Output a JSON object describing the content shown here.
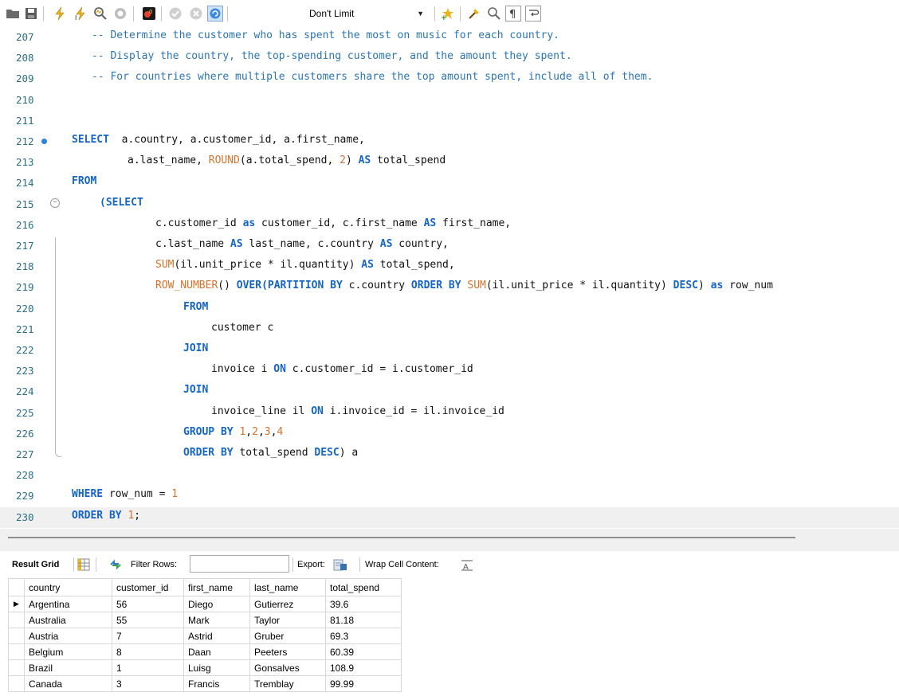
{
  "toolbar": {
    "limit_value": "Don't Limit",
    "icons": [
      "folder-open-icon",
      "save-icon",
      "execute-icon",
      "execute-selection-icon",
      "explain-icon",
      "stop-icon",
      "toggle-error-stop-icon",
      "commit-icon",
      "rollback-icon",
      "autocommit-icon",
      "add-snippet-icon",
      "beautify-icon",
      "find-icon",
      "invisible-chars-icon",
      "wrap-icon"
    ]
  },
  "editor": {
    "lines": [
      {
        "n": "207",
        "tokens": [
          {
            "t": "cm",
            "v": "-- Determine the customer who has spent the most on music for each country."
          }
        ],
        "indent": 115
      },
      {
        "n": "208",
        "tokens": [
          {
            "t": "cm",
            "v": "-- Display the country, the top-spending customer, and the amount they spent."
          }
        ],
        "indent": 115
      },
      {
        "n": "209",
        "tokens": [
          {
            "t": "cm",
            "v": "-- For countries where multiple customers share the top amount spent, include all of them."
          }
        ],
        "indent": 115
      },
      {
        "n": "210",
        "tokens": [],
        "indent": 115
      },
      {
        "n": "211",
        "tokens": [],
        "indent": 115
      },
      {
        "n": "212",
        "tokens": [
          {
            "t": "kw",
            "v": "SELECT"
          },
          {
            "t": "id",
            "v": "  a.country, a.customer_id, a.first_name,"
          }
        ],
        "indent": 90,
        "breakpoint": true
      },
      {
        "n": "213",
        "tokens": [
          {
            "t": "id",
            "v": "a.last_name, "
          },
          {
            "t": "fn",
            "v": "ROUND"
          },
          {
            "t": "id",
            "v": "(a.total_spend, "
          },
          {
            "t": "num",
            "v": "2"
          },
          {
            "t": "id",
            "v": ") "
          },
          {
            "t": "kw",
            "v": "AS"
          },
          {
            "t": "id",
            "v": " total_spend"
          }
        ],
        "indent": 160
      },
      {
        "n": "214",
        "tokens": [
          {
            "t": "kw",
            "v": "FROM"
          }
        ],
        "indent": 90
      },
      {
        "n": "215",
        "tokens": [
          {
            "t": "kw",
            "v": "(SELECT"
          }
        ],
        "indent": 125,
        "fold": true
      },
      {
        "n": "216",
        "tokens": [
          {
            "t": "id",
            "v": "c.customer_id "
          },
          {
            "t": "kw",
            "v": "as"
          },
          {
            "t": "id",
            "v": " customer_id, c.first_name "
          },
          {
            "t": "kw",
            "v": "AS"
          },
          {
            "t": "id",
            "v": " first_name,"
          }
        ],
        "indent": 195
      },
      {
        "n": "217",
        "tokens": [
          {
            "t": "id",
            "v": "c.last_name "
          },
          {
            "t": "kw",
            "v": "AS"
          },
          {
            "t": "id",
            "v": " last_name, c.country "
          },
          {
            "t": "kw",
            "v": "AS"
          },
          {
            "t": "id",
            "v": " country,"
          }
        ],
        "indent": 195
      },
      {
        "n": "218",
        "tokens": [
          {
            "t": "fn",
            "v": "SUM"
          },
          {
            "t": "id",
            "v": "(il.unit_price * il.quantity) "
          },
          {
            "t": "kw",
            "v": "AS"
          },
          {
            "t": "id",
            "v": " total_spend,"
          }
        ],
        "indent": 195
      },
      {
        "n": "219",
        "tokens": [
          {
            "t": "fn",
            "v": "ROW_NUMBER"
          },
          {
            "t": "id",
            "v": "() "
          },
          {
            "t": "kw",
            "v": "OVER(PARTITION BY"
          },
          {
            "t": "id",
            "v": " c.country "
          },
          {
            "t": "kw",
            "v": "ORDER BY"
          },
          {
            "t": "id",
            "v": " "
          },
          {
            "t": "fn",
            "v": "SUM"
          },
          {
            "t": "id",
            "v": "(il.unit_price * il.quantity) "
          },
          {
            "t": "kw",
            "v": "DESC"
          },
          {
            "t": "id",
            "v": ") "
          },
          {
            "t": "kw",
            "v": "as"
          },
          {
            "t": "id",
            "v": " row_num"
          }
        ],
        "indent": 195
      },
      {
        "n": "220",
        "tokens": [
          {
            "t": "kw",
            "v": "FROM"
          }
        ],
        "indent": 230
      },
      {
        "n": "221",
        "tokens": [
          {
            "t": "id",
            "v": "customer c"
          }
        ],
        "indent": 265
      },
      {
        "n": "222",
        "tokens": [
          {
            "t": "kw",
            "v": "JOIN"
          }
        ],
        "indent": 230
      },
      {
        "n": "223",
        "tokens": [
          {
            "t": "id",
            "v": "invoice i "
          },
          {
            "t": "kw",
            "v": "ON"
          },
          {
            "t": "id",
            "v": " c.customer_id = i.customer_id"
          }
        ],
        "indent": 265
      },
      {
        "n": "224",
        "tokens": [
          {
            "t": "kw",
            "v": "JOIN"
          }
        ],
        "indent": 230
      },
      {
        "n": "225",
        "tokens": [
          {
            "t": "id",
            "v": "invoice_line il "
          },
          {
            "t": "kw",
            "v": "ON"
          },
          {
            "t": "id",
            "v": " i.invoice_id = il.invoice_id"
          }
        ],
        "indent": 265
      },
      {
        "n": "226",
        "tokens": [
          {
            "t": "kw",
            "v": "GROUP BY"
          },
          {
            "t": "id",
            "v": " "
          },
          {
            "t": "num",
            "v": "1"
          },
          {
            "t": "id",
            "v": ","
          },
          {
            "t": "num",
            "v": "2"
          },
          {
            "t": "id",
            "v": ","
          },
          {
            "t": "num",
            "v": "3"
          },
          {
            "t": "id",
            "v": ","
          },
          {
            "t": "num",
            "v": "4"
          }
        ],
        "indent": 230
      },
      {
        "n": "227",
        "tokens": [
          {
            "t": "kw",
            "v": "ORDER BY"
          },
          {
            "t": "id",
            "v": " total_spend "
          },
          {
            "t": "kw",
            "v": "DESC"
          },
          {
            "t": "id",
            "v": ") a"
          }
        ],
        "indent": 230
      },
      {
        "n": "228",
        "tokens": [],
        "indent": 90
      },
      {
        "n": "229",
        "tokens": [
          {
            "t": "kw",
            "v": "WHERE"
          },
          {
            "t": "id",
            "v": " row_num = "
          },
          {
            "t": "num",
            "v": "1"
          }
        ],
        "indent": 90
      },
      {
        "n": "230",
        "tokens": [
          {
            "t": "kw",
            "v": "ORDER BY"
          },
          {
            "t": "id",
            "v": " "
          },
          {
            "t": "num",
            "v": "1"
          },
          {
            "t": "id",
            "v": ";"
          }
        ],
        "indent": 90,
        "current": true
      }
    ]
  },
  "result_toolbar": {
    "result_grid_label": "Result Grid",
    "filter_rows_label": "Filter Rows:",
    "filter_value": "",
    "export_label": "Export:",
    "wrap_label": "Wrap Cell Content:"
  },
  "grid": {
    "columns": [
      "country",
      "customer_id",
      "first_name",
      "last_name",
      "total_spend"
    ],
    "rows": [
      [
        "Argentina",
        "56",
        "Diego",
        "Gutierrez",
        "39.6"
      ],
      [
        "Australia",
        "55",
        "Mark",
        "Taylor",
        "81.18"
      ],
      [
        "Austria",
        "7",
        "Astrid",
        "Gruber",
        "69.3"
      ],
      [
        "Belgium",
        "8",
        "Daan",
        "Peeters",
        "60.39"
      ],
      [
        "Brazil",
        "1",
        "Luisg",
        "Gonsalves",
        "108.9"
      ],
      [
        "Canada",
        "3",
        "Francis",
        "Tremblay",
        "99.99"
      ]
    ],
    "current_row_marker": "▶"
  }
}
